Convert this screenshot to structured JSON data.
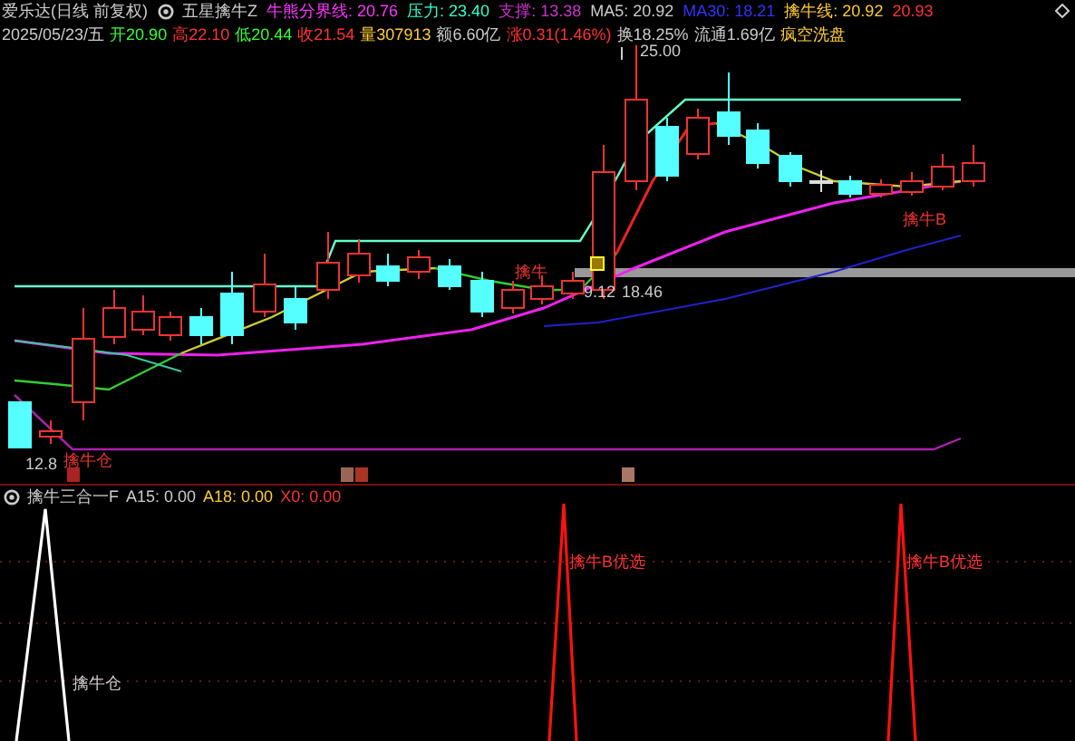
{
  "header": {
    "stock": "爱乐达(日线 前复权)",
    "indicator": "五星擒牛Z",
    "values": [
      {
        "text": "牛熊分界线: 20.76",
        "color": "#ff33ff"
      },
      {
        "text": "压力: 23.40",
        "color": "#33ffcc"
      },
      {
        "text": "支撑: 13.38",
        "color": "#cc33cc"
      },
      {
        "text": "MA5: 20.92",
        "color": "#cccccc"
      },
      {
        "text": "MA30: 18.21",
        "color": "#3333ff"
      },
      {
        "text": "擒牛线: 20.92",
        "color": "#ffcc33"
      },
      {
        "text": "20.93",
        "color": "#ff3333"
      }
    ]
  },
  "quote": [
    {
      "text": "2025/05/23/五",
      "color": "#cccccc"
    },
    {
      "text": "开20.90",
      "color": "#33ff33"
    },
    {
      "text": "高22.10",
      "color": "#ff3333"
    },
    {
      "text": "低20.44",
      "color": "#33ff33"
    },
    {
      "text": "收21.54",
      "color": "#ff3333"
    },
    {
      "text": "量307913",
      "color": "#ffcc33"
    },
    {
      "text": "额6.60亿",
      "color": "#cccccc"
    },
    {
      "text": "涨0.31(1.46%)",
      "color": "#ff3333"
    },
    {
      "text": "换18.25%",
      "color": "#cccccc"
    },
    {
      "text": "流通1.69亿",
      "color": "#cccccc"
    },
    {
      "text": "疯空洗盘",
      "color": "#ffcc33"
    }
  ],
  "chart_labels": {
    "high": "25.00",
    "low": "12.8",
    "mid_low": "9.12",
    "mid_value": "18.46",
    "buy_position": "擒牛仓",
    "signal_b": "擒牛B",
    "signal_mid": "擒牛"
  },
  "lower": {
    "title": "擒牛三合一F",
    "values": [
      {
        "text": "A15: 0.00",
        "color": "#cccccc"
      },
      {
        "text": "A18: 0.00",
        "color": "#ffcc33"
      },
      {
        "text": "X0: 0.00",
        "color": "#ff3333"
      }
    ],
    "labels": [
      {
        "text": "擒牛仓",
        "color": "#cccccc"
      },
      {
        "text": "擒牛B优选",
        "color": "#ff3333"
      },
      {
        "text": "擒牛B优选",
        "color": "#ff3333"
      }
    ]
  }
}
